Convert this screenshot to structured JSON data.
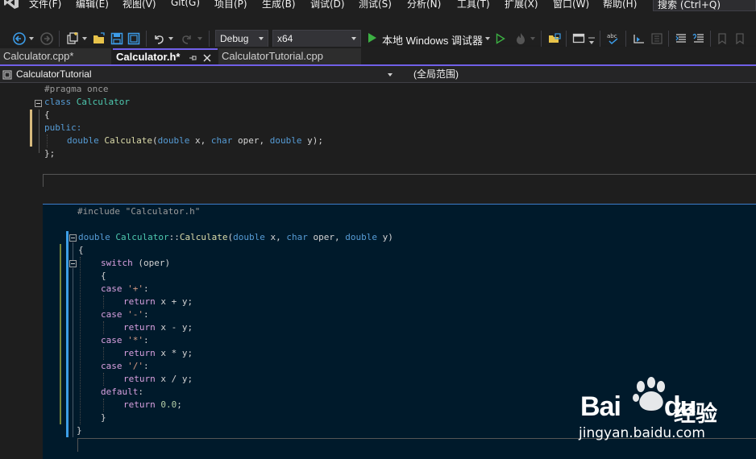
{
  "menu": {
    "items": [
      "文件(F)",
      "编辑(E)",
      "视图(V)",
      "Git(G)",
      "项目(P)",
      "生成(B)",
      "调试(D)",
      "测试(S)",
      "分析(N)",
      "工具(T)",
      "扩展(X)",
      "窗口(W)",
      "帮助(H)"
    ],
    "search_placeholder": "搜索 (Ctrl+Q)"
  },
  "toolbar": {
    "config": "Debug",
    "platform": "x64",
    "run_label": "本地 Windows 调试器",
    "icons": [
      "back-icon",
      "forward-icon",
      "new-project-icon",
      "open-file-icon",
      "save-icon",
      "save-all-icon",
      "undo-icon",
      "redo-icon",
      "start-without-debug-icon",
      "hot-reload-icon",
      "solution-explorer-icon",
      "window-layout-icon",
      "spell-check-icon",
      "comment-icon",
      "bookmark-icon"
    ]
  },
  "tabs": [
    {
      "label": "Calculator.cpp*",
      "active": false
    },
    {
      "label": "Calculator.h*",
      "active": true
    },
    {
      "label": "CalculatorTutorial.cpp",
      "active": false
    }
  ],
  "navbar": {
    "project": "CalculatorTutorial",
    "scope": "(全局范围)"
  },
  "editor": {
    "line1": "#pragma once",
    "line2_kw": "class",
    "line2_name": "Calculator",
    "line3": "{",
    "line4": "public:",
    "line5_type1": "double",
    "line5_fn": "Calculate",
    "line5_params_a": "(",
    "line5_type2": "double",
    "line5_params_b": " x, ",
    "line5_type3": "char",
    "line5_params_c": " oper, ",
    "line5_type4": "double",
    "line5_params_d": " y);",
    "line6": "};"
  },
  "peek": {
    "include_dir": "#include",
    "include_file": "\"Calculator.h\"",
    "sig_type": "double",
    "sig_class": "Calculator",
    "sig_sep": "::",
    "sig_fn": "Calculate",
    "sig_p1": "(",
    "sig_t2": "double",
    "sig_p2": " x, ",
    "sig_t3": "char",
    "sig_p3": " oper, ",
    "sig_t4": "double",
    "sig_p4": " y)",
    "open_brace": "{",
    "switch_kw": "switch",
    "switch_arg": " (oper)",
    "inner_open": "{",
    "cases": [
      {
        "kw": "case",
        "lit": "'+'",
        "colon": ":",
        "ret": "return",
        "expr": " x + y;"
      },
      {
        "kw": "case",
        "lit": "'-'",
        "colon": ":",
        "ret": "return",
        "expr": " x - y;"
      },
      {
        "kw": "case",
        "lit": "'*'",
        "colon": ":",
        "ret": "return",
        "expr": " x * y;"
      },
      {
        "kw": "case",
        "lit": "'/'",
        "colon": ":",
        "ret": "return",
        "expr": " x / y;"
      }
    ],
    "default_kw": "default",
    "default_colon": ":",
    "default_ret": "return",
    "default_num": "0.0",
    "default_semi": ";",
    "inner_close": "}",
    "close_brace": "}"
  },
  "watermark": {
    "brand_a": "Bai",
    "brand_b": "du",
    "brand_cn": "经验",
    "url": "jingyan.baidu.com"
  },
  "colors": {
    "accent": "#7160e8",
    "keyword": "#569cd6",
    "type": "#4ec9b0",
    "function": "#dcdcaa",
    "preprocessor": "#9b9b9b",
    "string": "#d69d85",
    "number": "#b5cea8",
    "peek_bg": "#001a2b",
    "change_bar": "#d7ba7d",
    "modified_bar": "#3d9fe8",
    "watermark_red": "#de0000",
    "watermark_blue": "#2932e1"
  }
}
